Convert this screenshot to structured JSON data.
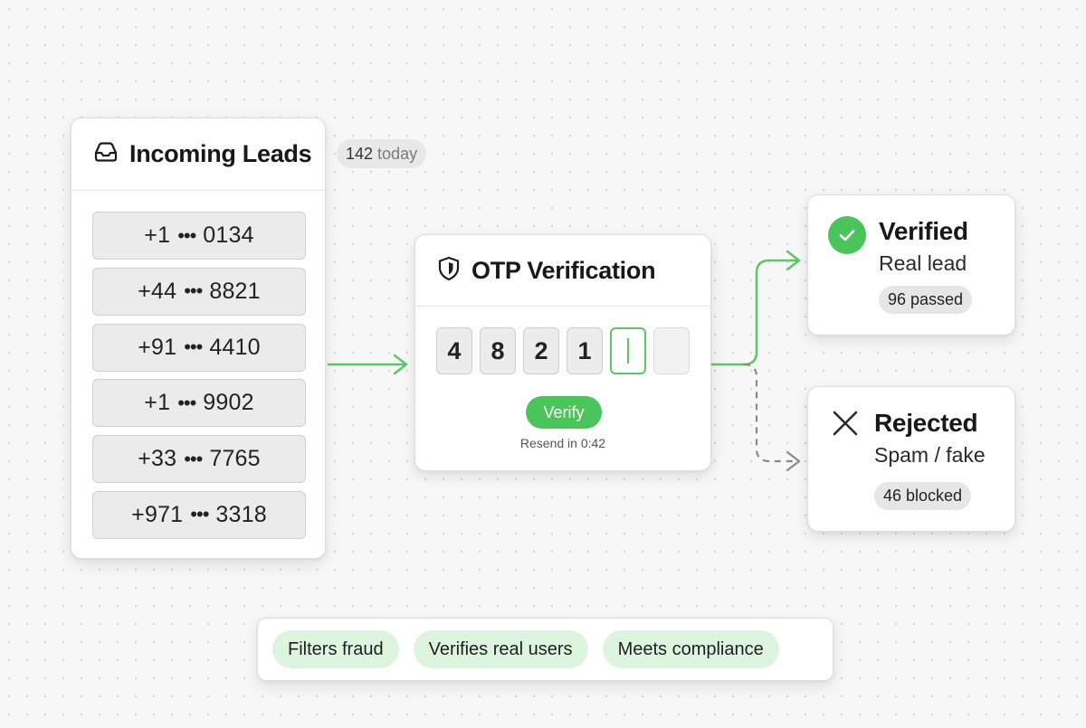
{
  "leads": {
    "title": "Incoming Leads",
    "count_value": "142",
    "count_unit": "today",
    "items": [
      {
        "code": "+1",
        "masked": "•••",
        "suffix": "0134"
      },
      {
        "code": "+44",
        "masked": "•••",
        "suffix": "8821"
      },
      {
        "code": "+91",
        "masked": "•••",
        "suffix": "4410"
      },
      {
        "code": "+1",
        "masked": "•••",
        "suffix": "9902"
      },
      {
        "code": "+33",
        "masked": "•••",
        "suffix": "7765"
      },
      {
        "code": "+971",
        "masked": "•••",
        "suffix": "3318"
      }
    ]
  },
  "otp": {
    "title": "OTP Verification",
    "digits": [
      "4",
      "8",
      "2",
      "1",
      "",
      ""
    ],
    "verify_label": "Verify",
    "resend_text": "Resend in 0:42"
  },
  "verified": {
    "title": "Verified",
    "subtitle": "Real lead",
    "badge": "96 passed"
  },
  "rejected": {
    "title": "Rejected",
    "subtitle": "Spam / fake",
    "badge": "46 blocked"
  },
  "benefits": [
    "Filters fraud",
    "Verifies real users",
    "Meets compliance"
  ],
  "colors": {
    "accent_green": "#4cc45c",
    "pill_green": "#ddf5df",
    "dashed_gray": "#8a8a8a"
  },
  "icons": {
    "leads": "inbox-icon",
    "otp": "shield-icon",
    "verified": "check-circle-icon",
    "rejected": "close-icon"
  }
}
